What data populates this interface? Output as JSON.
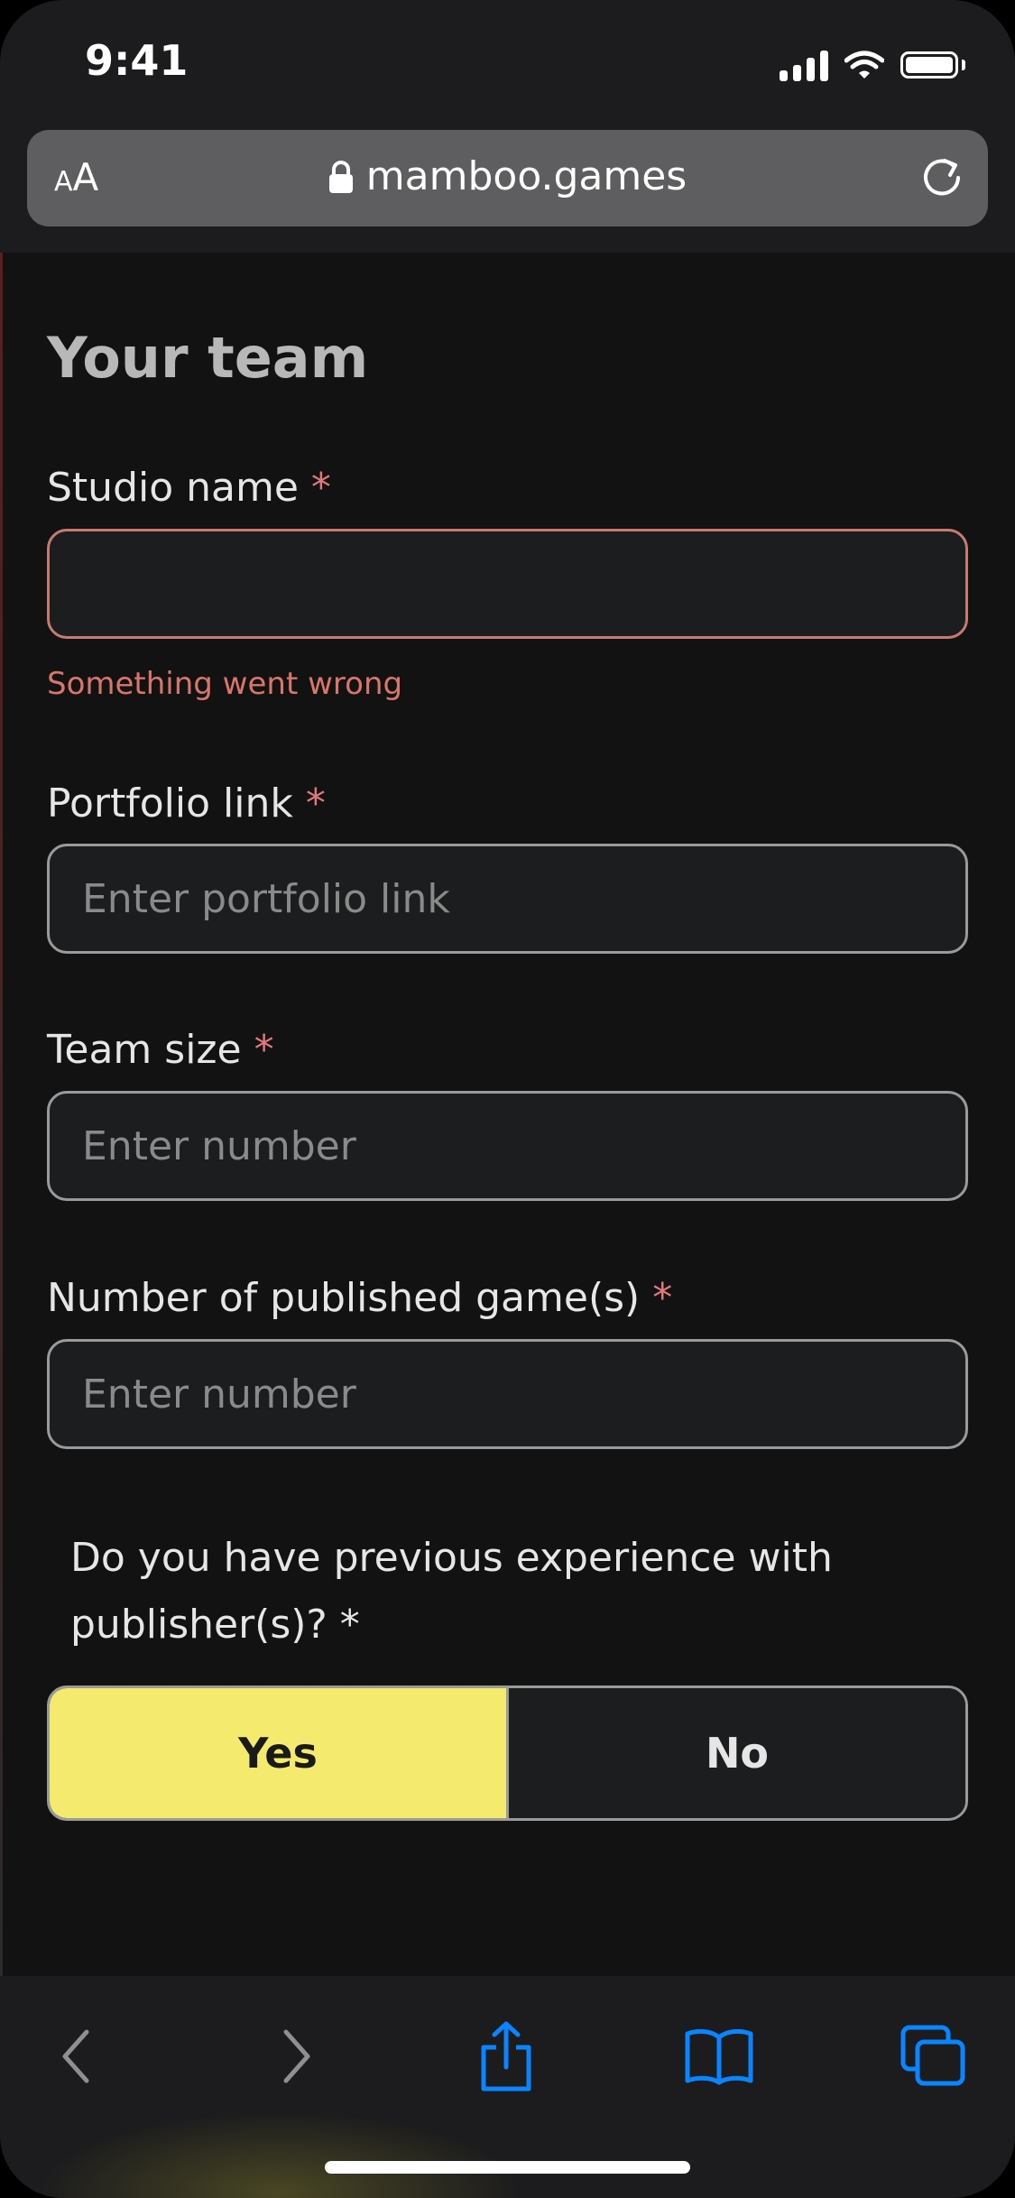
{
  "status_bar": {
    "time": "9:41"
  },
  "browser": {
    "text_size_small": "A",
    "text_size_large": "A",
    "domain": "mamboo.games"
  },
  "form": {
    "heading": "Your team",
    "studio_name": {
      "label": "Studio name",
      "required": "*",
      "value": "",
      "placeholder": "",
      "error": "Something went wrong"
    },
    "portfolio_link": {
      "label": "Portfolio link",
      "required": "*",
      "placeholder": "Enter portfolio link"
    },
    "team_size": {
      "label": "Team size",
      "required": "*",
      "placeholder": "Enter number"
    },
    "published_games": {
      "label": "Number of published game(s)",
      "required": "*",
      "placeholder": "Enter number"
    },
    "publisher_experience": {
      "question": "Do you have previous experience with publisher(s)? *",
      "options": [
        "Yes",
        "No"
      ],
      "selected": "Yes"
    }
  },
  "colors": {
    "accent_yellow": "#f4ea6e",
    "error_red": "#d9756b",
    "ios_blue": "#0a84ff"
  },
  "toolbar": {
    "icons": [
      "back-icon",
      "forward-icon",
      "share-icon",
      "bookmarks-icon",
      "tabs-icon"
    ]
  }
}
